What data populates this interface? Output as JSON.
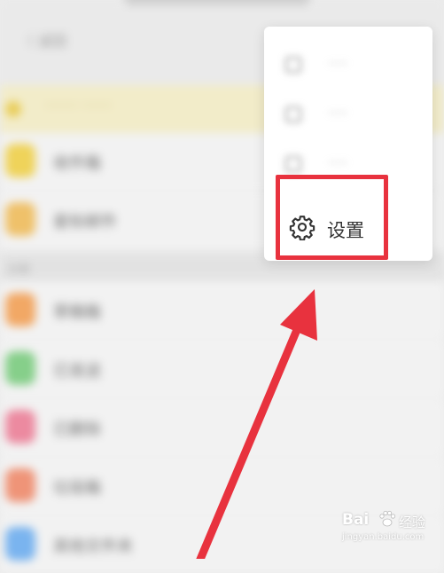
{
  "background": {
    "back_label": "〈 返回",
    "notice_text": "········ ·······",
    "rows_top": [
      {
        "label": "收件箱",
        "color": "#efd35a"
      },
      {
        "label": "星标邮件",
        "color": "#efc16a"
      }
    ],
    "section_label": "分类",
    "rows_bottom": [
      {
        "label": "草稿箱",
        "color": "#f2a865"
      },
      {
        "label": "已发送",
        "color": "#86cf8a"
      },
      {
        "label": "已删除",
        "color": "#ec8aa0"
      },
      {
        "label": "垃圾箱",
        "color": "#ef9478"
      },
      {
        "label": "其他文件夹",
        "color": "#7ab4ef"
      }
    ]
  },
  "menu": {
    "blurred_items": [
      {
        "label": "·····"
      },
      {
        "label": "·····"
      },
      {
        "label": "·····"
      }
    ],
    "settings": {
      "label": "设置",
      "icon": "gear-icon"
    }
  },
  "annotation": {
    "highlight_color": "#e8323e"
  },
  "watermark": {
    "brand": "Bai",
    "text": "经验",
    "url": "jingyan.baidu.com"
  }
}
